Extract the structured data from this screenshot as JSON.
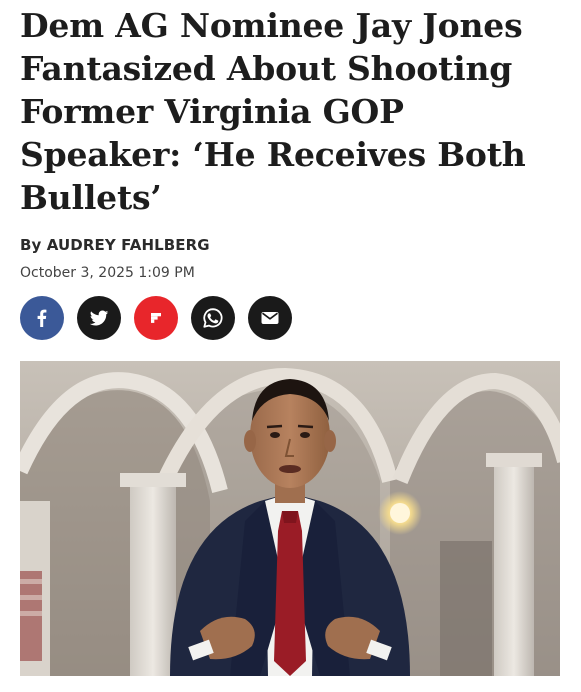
{
  "article": {
    "headline": "Dem AG Nominee Jay Jones Fantasized About Shooting Former Virginia GOP Speaker: ‘He Receives Both Bullets’",
    "byline_prefix": "By",
    "author": "AUDREY FAHLBERG",
    "timestamp": "October 3, 2025 1:09 PM"
  },
  "share": {
    "buttons": [
      {
        "name": "facebook",
        "icon": "facebook-icon",
        "color": "#3b5998"
      },
      {
        "name": "x",
        "icon": "bird-icon",
        "color": "#1a1a1a"
      },
      {
        "name": "flipboard",
        "icon": "flipboard-icon",
        "color": "#e8262b"
      },
      {
        "name": "whatsapp",
        "icon": "whatsapp-icon",
        "color": "#1a1a1a"
      },
      {
        "name": "email",
        "icon": "envelope-icon",
        "color": "#1a1a1a"
      }
    ]
  },
  "hero_image": {
    "subject": "man-in-suit-speaking"
  }
}
